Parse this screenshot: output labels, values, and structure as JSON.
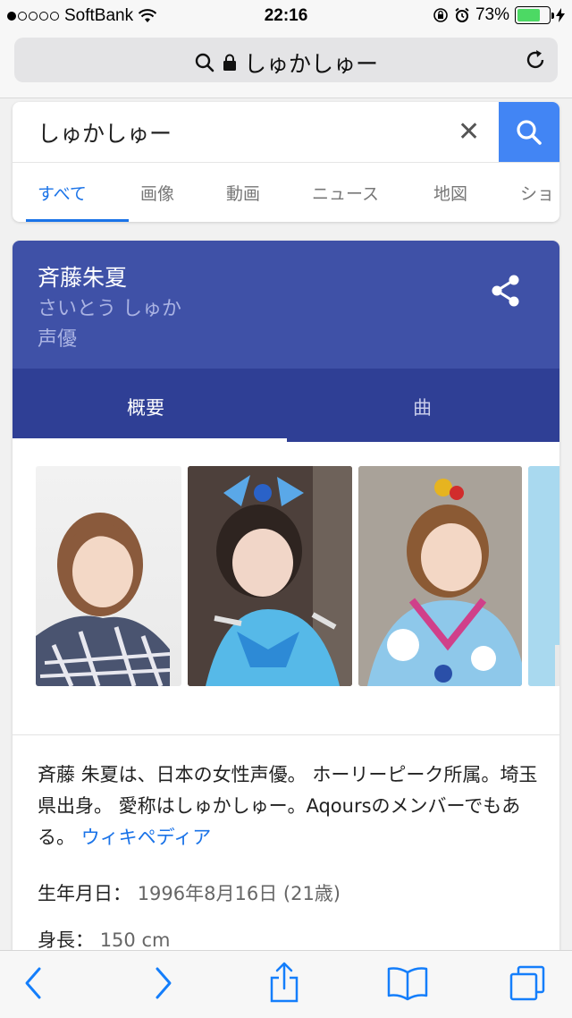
{
  "status_bar": {
    "carrier": "SoftBank",
    "time": "22:16",
    "battery": "73%",
    "battery_level": 0.73
  },
  "address_bar": {
    "text": "しゅかしゅー"
  },
  "search": {
    "query": "しゅかしゅー",
    "tabs": [
      "すべて",
      "画像",
      "動画",
      "ニュース",
      "地図",
      "ショ"
    ],
    "active_tab": "すべて"
  },
  "knowledge_card": {
    "name": "斉藤朱夏",
    "reading": "さいとう しゅか",
    "occupation": "声優",
    "tabs": [
      "概要",
      "曲"
    ],
    "description": "斉藤 朱夏は、日本の女性声優。 ホーリーピーク所属。埼玉県出身。 愛称はしゅかしゅー。Aqoursのメンバーでもある。",
    "wiki_link": "ウィキペディア",
    "facts": [
      {
        "label": "生年月日：",
        "value": "1996年8月16日 (21歳)"
      },
      {
        "label": "身長：",
        "value": "150 cm"
      }
    ]
  },
  "colors": {
    "card_header": "#3f51a7",
    "card_tabs": "#2f3f95",
    "google_blue": "#4285f4",
    "link": "#1a73e8"
  }
}
